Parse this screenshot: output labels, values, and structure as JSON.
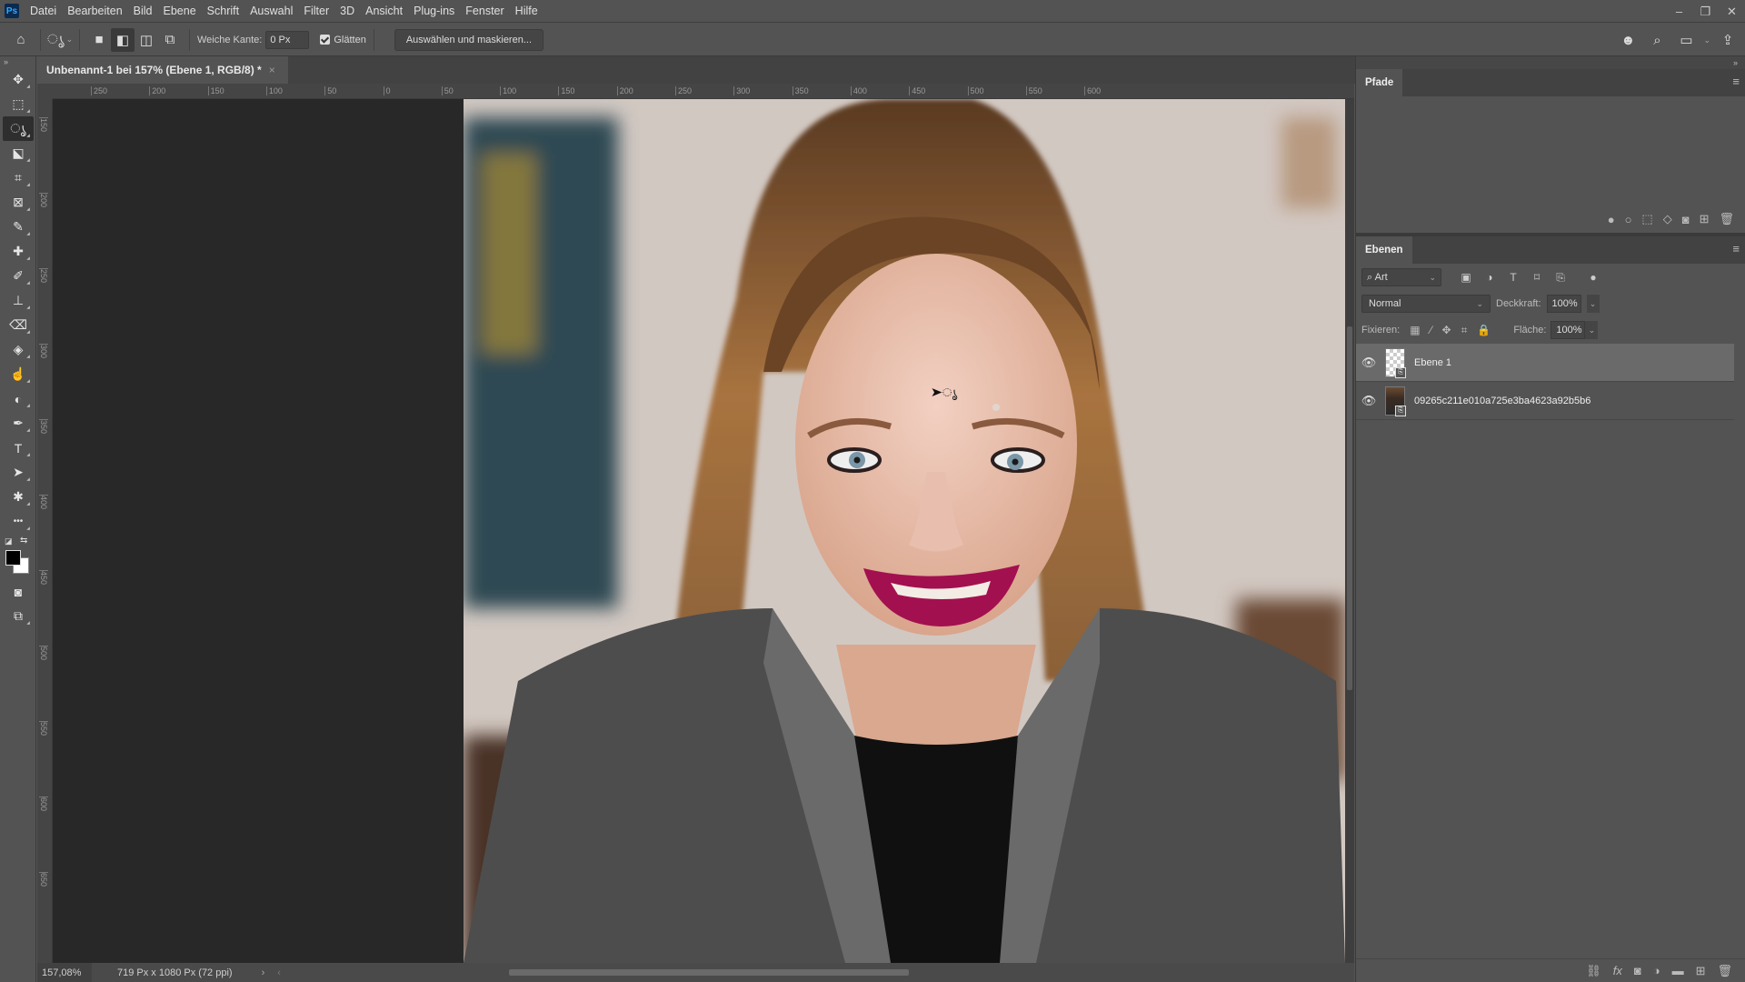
{
  "app": {
    "logo": "Ps",
    "window_controls": {
      "minimize": "–",
      "restore": "❐",
      "close": "✕"
    }
  },
  "menu": [
    "Datei",
    "Bearbeiten",
    "Bild",
    "Ebene",
    "Schrift",
    "Auswahl",
    "Filter",
    "3D",
    "Ansicht",
    "Plug-ins",
    "Fenster",
    "Hilfe"
  ],
  "options": {
    "feather_label": "Weiche Kante:",
    "feather_value": "0 Px",
    "antialias_label": "Glätten",
    "antialias_checked": true,
    "select_mask_label": "Auswählen und maskieren..."
  },
  "tools": [
    {
      "name": "move-tool",
      "glyph": "✥"
    },
    {
      "name": "marquee-tool",
      "glyph": "⬚"
    },
    {
      "name": "lasso-tool",
      "glyph": "ൃ",
      "active": true
    },
    {
      "name": "object-selection-tool",
      "glyph": "⬕"
    },
    {
      "name": "crop-tool",
      "glyph": "⌗"
    },
    {
      "name": "frame-tool",
      "glyph": "⊠"
    },
    {
      "name": "eyedropper-tool",
      "glyph": "✎"
    },
    {
      "name": "healing-brush-tool",
      "glyph": "✚"
    },
    {
      "name": "brush-tool",
      "glyph": "✐"
    },
    {
      "name": "clone-stamp-tool",
      "glyph": "⊥"
    },
    {
      "name": "eraser-tool",
      "glyph": "⌫"
    },
    {
      "name": "paint-bucket-tool",
      "glyph": "◈"
    },
    {
      "name": "smudge-tool",
      "glyph": "☝"
    },
    {
      "name": "dodge-tool",
      "glyph": "◐"
    },
    {
      "name": "pen-tool",
      "glyph": "✒"
    },
    {
      "name": "type-tool",
      "glyph": "T"
    },
    {
      "name": "path-selection-tool",
      "glyph": "➤"
    },
    {
      "name": "custom-shape-tool",
      "glyph": "✱"
    },
    {
      "name": "more-tools",
      "glyph": "•••"
    }
  ],
  "colors": {
    "foreground": "#000000",
    "background": "#ffffff"
  },
  "document": {
    "tab_title": "Unbenannt-1 bei 157% (Ebene 1, RGB/8) *",
    "close": "×",
    "zoom": "157,08%",
    "info": "719 Px x 1080 Px (72 ppi)",
    "ruler_h": [
      "250",
      "200",
      "150",
      "100",
      "50",
      "0",
      "50",
      "100",
      "150",
      "200",
      "250",
      "300",
      "350",
      "400",
      "450",
      "500",
      "550",
      "600"
    ],
    "ruler_v": [
      "150",
      "200",
      "250",
      "300",
      "350",
      "400",
      "450",
      "500",
      "550",
      "600",
      "650"
    ]
  },
  "panels": {
    "pfade": {
      "title": "Pfade"
    },
    "ebenen": {
      "title": "Ebenen",
      "filter_label": "Art",
      "blend_mode": "Normal",
      "opacity_label": "Deckkraft:",
      "opacity_value": "100%",
      "lock_label": "Fixieren:",
      "fill_label": "Fläche:",
      "fill_value": "100%",
      "layers": [
        {
          "name": "Ebene 1",
          "visible": true,
          "selected": true
        },
        {
          "name": "09265c211e010a725e3ba4623a92b5b6",
          "visible": true,
          "selected": false
        }
      ]
    }
  }
}
